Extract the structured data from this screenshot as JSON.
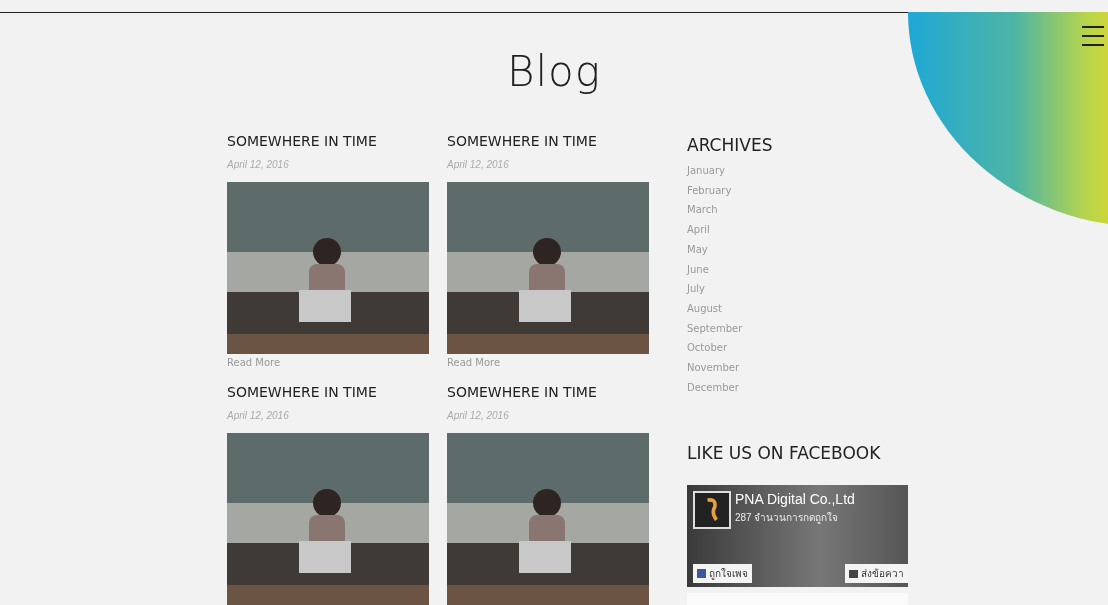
{
  "page_title": "Blog",
  "posts": [
    {
      "title": "SOMEWHERE IN TIME",
      "date": "April 12, 2016",
      "link": "Read More"
    },
    {
      "title": "SOMEWHERE IN TIME",
      "date": "April 12, 2016",
      "link": "Read More"
    },
    {
      "title": "SOMEWHERE IN TIME",
      "date": "April 12, 2016"
    },
    {
      "title": "SOMEWHERE IN TIME",
      "date": "April 12, 2016"
    }
  ],
  "archives": {
    "heading": "ARCHIVES",
    "months": [
      "January",
      "February",
      "March",
      "April",
      "May",
      "June",
      "July",
      "August",
      "September",
      "October",
      "November",
      "December"
    ]
  },
  "facebook": {
    "heading": "LIKE US ON FACEBOOK",
    "page_name": "PNA Digital Co.,Ltd",
    "likes": "287 จำนวนการกดถูกใจ",
    "like_button": "ถูกใจเพจ",
    "message_button": "ส่งข้อควา"
  }
}
